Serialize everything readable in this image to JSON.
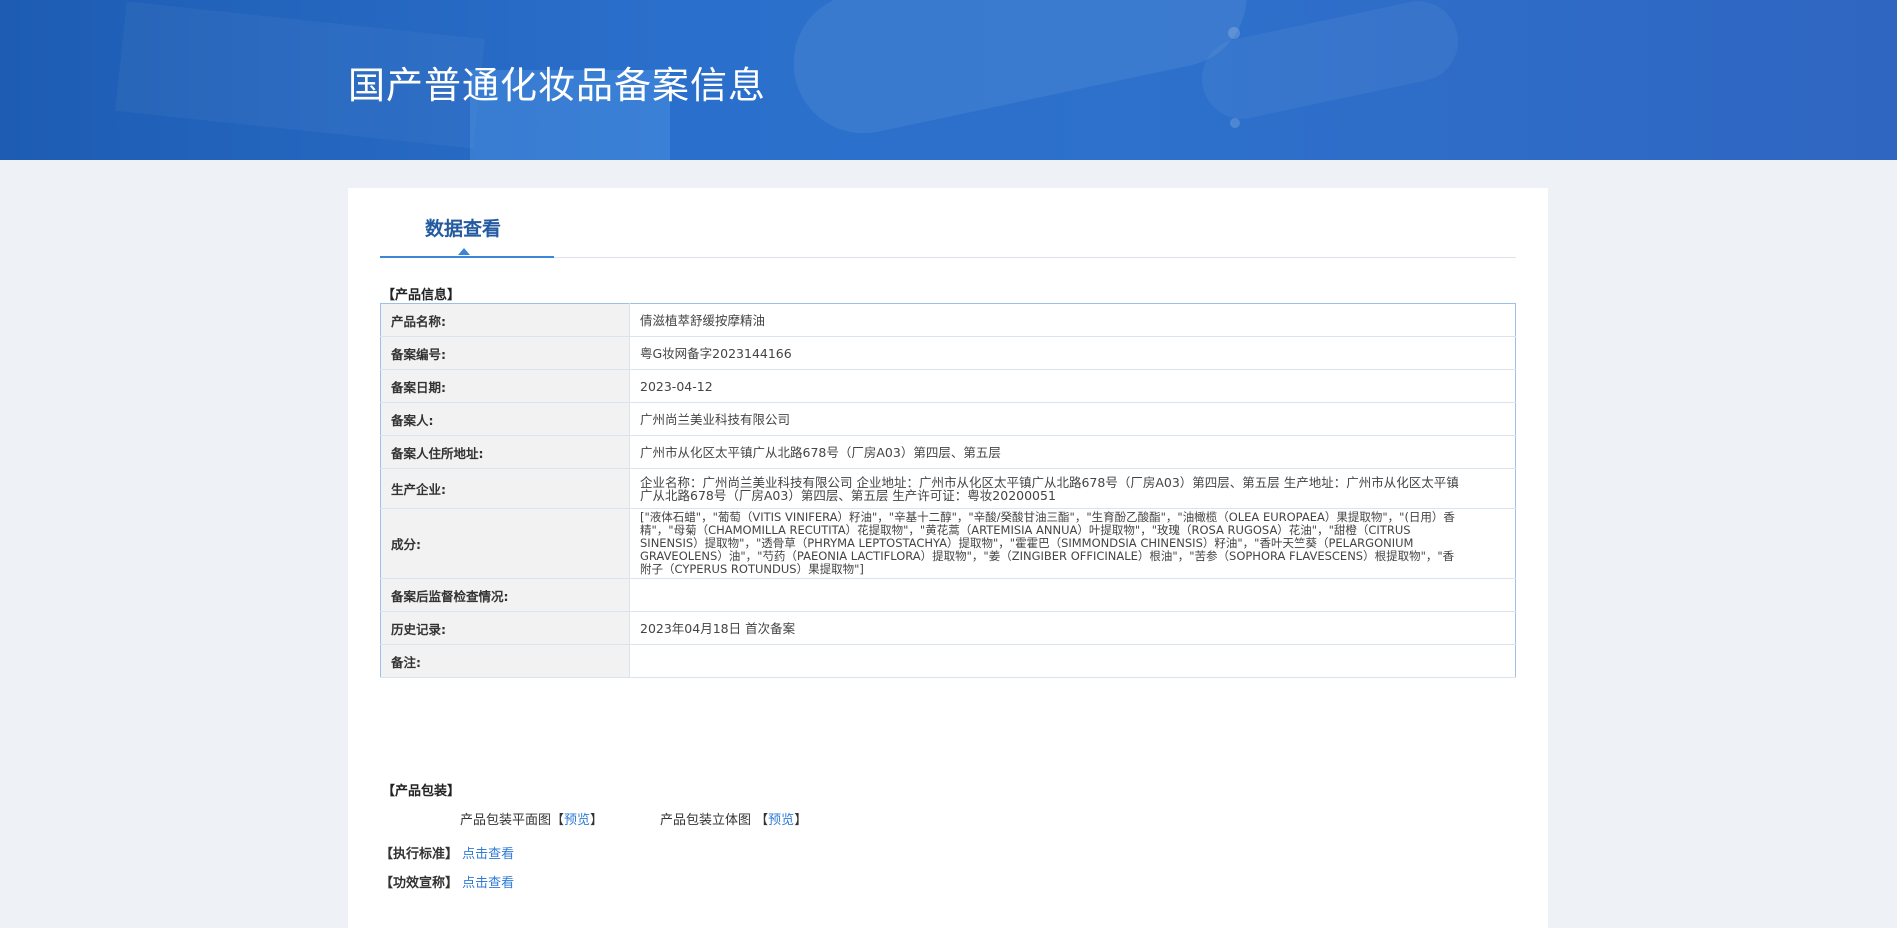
{
  "banner": {
    "title": "国产普通化妆品备案信息"
  },
  "tab": {
    "label": "数据查看"
  },
  "sections": {
    "product_info": "【产品信息】",
    "packaging": "【产品包装】",
    "standard": "【执行标准】",
    "efficacy": "【功效宣称】"
  },
  "rows": [
    {
      "label": "产品名称:",
      "value": "倩滋植萃舒缓按摩精油"
    },
    {
      "label": "备案编号:",
      "value": "粤G妆网备字2023144166"
    },
    {
      "label": "备案日期:",
      "value": "2023-04-12"
    },
    {
      "label": "备案人:",
      "value": "广州尚兰美业科技有限公司"
    },
    {
      "label": "备案人住所地址:",
      "value": "广州市从化区太平镇广从北路678号（厂房A03）第四层、第五层"
    },
    {
      "label": "生产企业:",
      "value": "企业名称：广州尚兰美业科技有限公司 企业地址：广州市从化区太平镇广从北路678号（厂房A03）第四层、第五层 生产地址：广州市从化区太平镇广从北路678号（厂房A03）第四层、第五层 生产许可证：粤妆20200051"
    },
    {
      "label": "成分:",
      "value": "[\"液体石蜡\"，\"葡萄（VITIS VINIFERA）籽油\"，\"辛基十二醇\"，\"辛酸/癸酸甘油三酯\"，\"生育酚乙酸酯\"，\"油橄榄（OLEA EUROPAEA）果提取物\"，\"(日用）香精\"，\"母菊（CHAMOMILLA RECUTITA）花提取物\"，\"黄花蒿（ARTEMISIA ANNUA）叶提取物\"，\"玫瑰（ROSA RUGOSA）花油\"，\"甜橙（CITRUS SINENSIS）提取物\"，\"透骨草（PHRYMA LEPTOSTACHYA）提取物\"，\"霍霍巴（SIMMONDSIA CHINENSIS）籽油\"，\"香叶天竺葵（PELARGONIUM GRAVEOLENS）油\"，\"芍药（PAEONIA LACTIFLORA）提取物\"，\"姜（ZINGIBER OFFICINALE）根油\"，\"苦参（SOPHORA FLAVESCENS）根提取物\"，\"香附子（CYPERUS ROTUNDUS）果提取物\"]"
    },
    {
      "label": "备案后监督检查情况:",
      "value": ""
    },
    {
      "label": "历史记录:",
      "value": "2023年04月18日 首次备案"
    },
    {
      "label": "备注:",
      "value": ""
    }
  ],
  "packaging": {
    "flat_label": "产品包装平面图",
    "flat_link": "预览",
    "solid_label": "产品包装立体图",
    "solid_link": "预览",
    "open_bracket": "【",
    "close_bracket": "】"
  },
  "links": {
    "standard": "点击查看",
    "efficacy": "点击查看"
  },
  "colors": {
    "banner": "#2a6fcb",
    "accent": "#3a86d8",
    "tab_text": "#235aa0",
    "link": "#2f7bd6"
  }
}
